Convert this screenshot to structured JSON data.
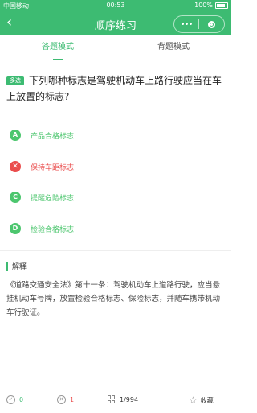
{
  "status_bar": {
    "carrier": "中国移动",
    "time": "00:53",
    "battery": "100%"
  },
  "nav": {
    "back_icon": "‹",
    "title": "顺序练习",
    "more_icon": "•••"
  },
  "tabs": [
    {
      "label": "答题模式",
      "active": true
    },
    {
      "label": "背题模式",
      "active": false
    }
  ],
  "question": {
    "type_badge": "多选",
    "text": "下列哪种标志是驾驶机动车上路行驶应当在车上放置的标志?"
  },
  "options": [
    {
      "letter": "A",
      "text": "产品合格标志",
      "state": "correct"
    },
    {
      "letter": "✕",
      "text": "保持车距标志",
      "state": "wrong"
    },
    {
      "letter": "C",
      "text": "提醒危险标志",
      "state": "correct"
    },
    {
      "letter": "D",
      "text": "检验合格标志",
      "state": "correct"
    }
  ],
  "explanation": {
    "title": "解释",
    "text": "《道路交通安全法》第十一条：驾驶机动车上道路行驶，应当悬挂机动车号牌，放置检验合格标志、保险标志，并随车携带机动车行驶证。"
  },
  "bottom_bar": {
    "correct_count": "0",
    "wrong_count": "1",
    "progress": "1/994",
    "favorite_label": "收藏"
  },
  "colors": {
    "accent": "#3dbb72",
    "wrong": "#ea4d4d",
    "option_correct": "#4cc66e"
  }
}
